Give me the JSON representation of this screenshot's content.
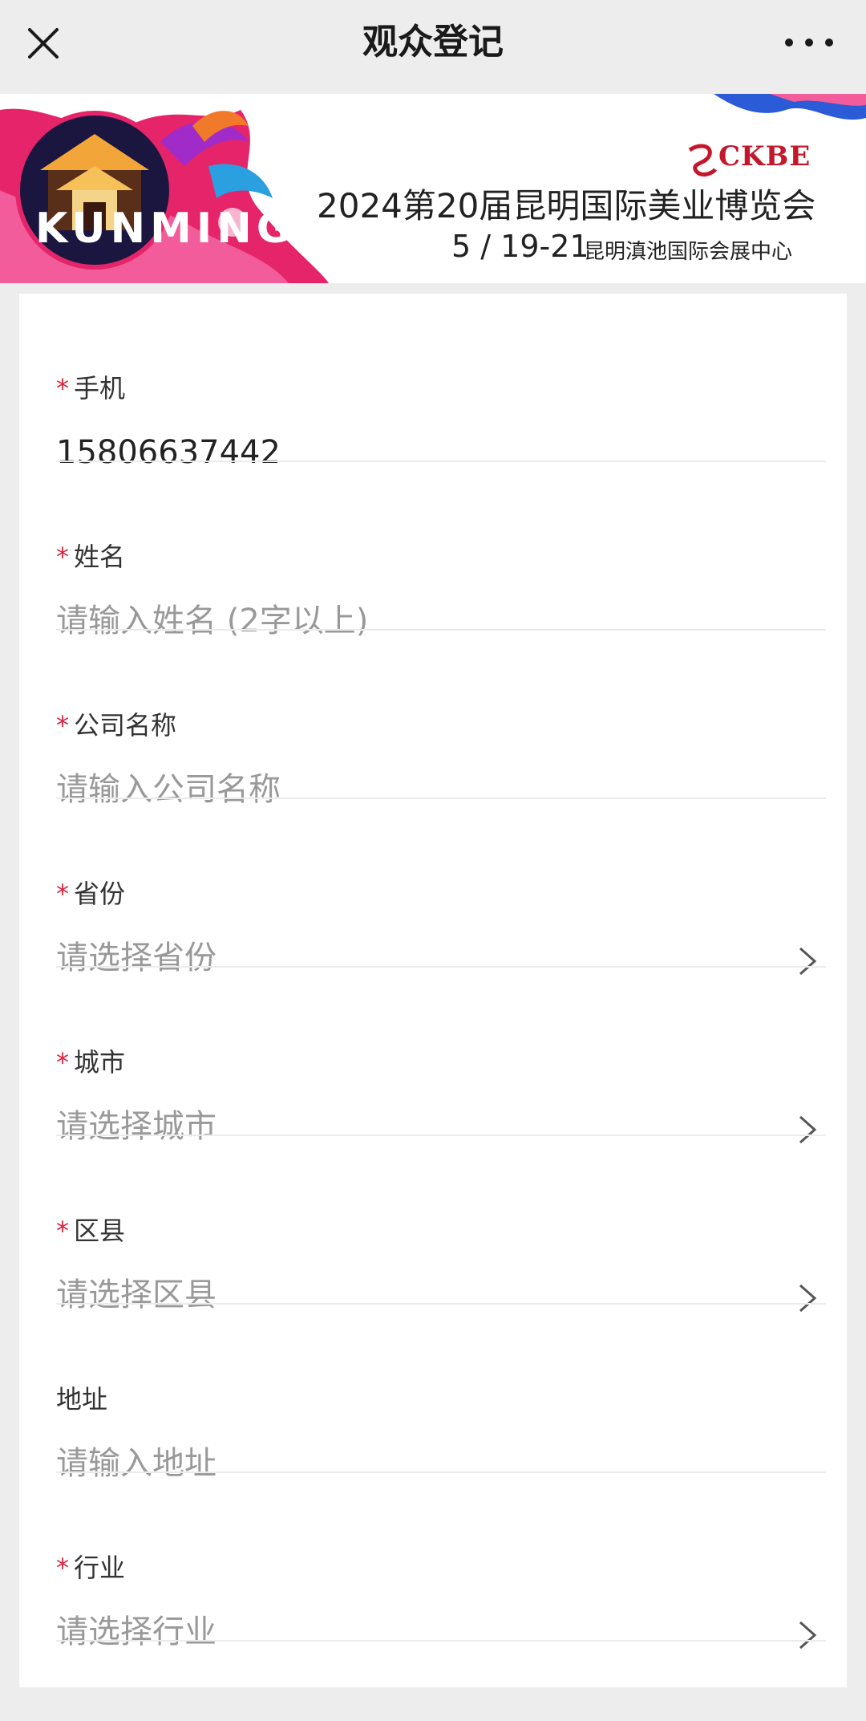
{
  "header": {
    "title": "观众登记",
    "close_icon": "close-icon",
    "more_icon": "more-icon"
  },
  "banner": {
    "city_text": "KUNMING",
    "logo_text": "CKBE",
    "event_title": "2024第20届昆明国际美业博览会",
    "event_date": "5 / 19-21",
    "event_venue": "昆明滇池国际会展中心",
    "accent_color": "#c3172c"
  },
  "form": {
    "required_mark": "*",
    "fields": [
      {
        "label": "手机",
        "value": "15806637442",
        "required": true,
        "type": "text"
      },
      {
        "label": "姓名",
        "placeholder": "请输入姓名 (2字以上)",
        "required": true,
        "type": "text"
      },
      {
        "label": "公司名称",
        "placeholder": "请输入公司名称",
        "required": true,
        "type": "text"
      },
      {
        "label": "省份",
        "placeholder": "请选择省份",
        "required": true,
        "type": "select"
      },
      {
        "label": "城市",
        "placeholder": "请选择城市",
        "required": true,
        "type": "select"
      },
      {
        "label": "区县",
        "placeholder": "请选择区县",
        "required": true,
        "type": "select"
      },
      {
        "label": "地址",
        "placeholder": "请输入地址",
        "required": false,
        "type": "text"
      },
      {
        "label": "行业",
        "placeholder": "请选择行业",
        "required": true,
        "type": "select"
      }
    ]
  }
}
